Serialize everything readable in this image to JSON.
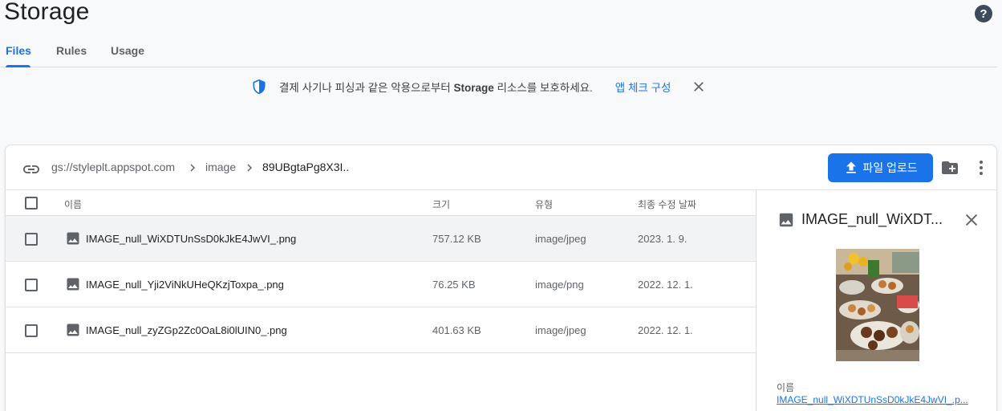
{
  "page": {
    "title": "Storage"
  },
  "tabs": [
    {
      "label": "Files"
    },
    {
      "label": "Rules"
    },
    {
      "label": "Usage"
    }
  ],
  "banner": {
    "message_pre": "결제 사기나 피싱과 같은 악용으로부터 ",
    "message_bold": "Storage",
    "message_post": " 리소스를 보호하세요.",
    "link": "앱 체크 구성"
  },
  "breadcrumb": {
    "bucket": "gs://styleplt.appspot.com",
    "folder": "image",
    "current": "89UBgtaPg8X3I.."
  },
  "toolbar": {
    "upload_label": "파일 업로드"
  },
  "table": {
    "headers": {
      "name": "이름",
      "size": "크기",
      "type": "유형",
      "modified": "최종 수정 날짜"
    },
    "rows": [
      {
        "name": "IMAGE_null_WiXDTUnSsD0kJkE4JwVI_.png",
        "size": "757.12 KB",
        "type": "image/jpeg",
        "modified": "2023. 1. 9."
      },
      {
        "name": "IMAGE_null_Yji2ViNkUHeQKzjToxpa_.png",
        "size": "76.25 KB",
        "type": "image/png",
        "modified": "2022. 12. 1."
      },
      {
        "name": "IMAGE_null_zyZGp2Zc0OaL8i0lUIN0_.png",
        "size": "401.63 KB",
        "type": "image/jpeg",
        "modified": "2022. 12. 1."
      }
    ]
  },
  "detail": {
    "title": "IMAGE_null_WiXDT...",
    "name_label": "이름",
    "name_value": "IMAGE_null_WiXDTUnSsD0kJkE4JwVI_.p..."
  },
  "colors": {
    "accent": "#1a73e8",
    "text": "#3c4043",
    "muted": "#5f6368"
  }
}
